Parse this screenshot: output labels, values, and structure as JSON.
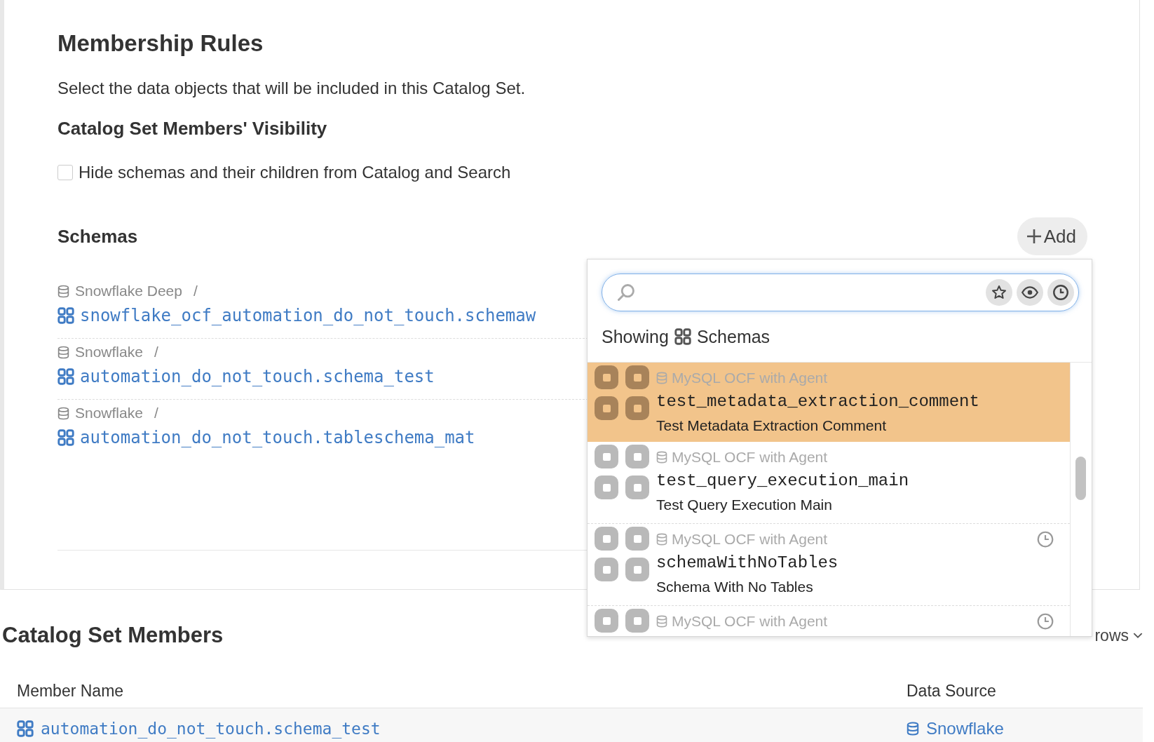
{
  "heading": "Membership Rules",
  "description": "Select the data objects that will be included in this Catalog Set.",
  "visibility": {
    "title": "Catalog Set Members' Visibility",
    "checkbox": {
      "label": "Hide schemas and their children from Catalog and Search",
      "checked": false
    }
  },
  "schemas": {
    "title": "Schemas",
    "add_label": "Add",
    "items": [
      {
        "source": "Snowflake Deep",
        "separator": "/",
        "name": "snowflake_ocf_automation_do_not_touch.schemaw"
      },
      {
        "source": "Snowflake",
        "separator": "/",
        "name": "automation_do_not_touch.schema_test"
      },
      {
        "source": "Snowflake",
        "separator": "/",
        "name": "automation_do_not_touch.tableschema_mat"
      }
    ]
  },
  "picker": {
    "showing_label": "Showing",
    "showing_type": "Schemas",
    "results": [
      {
        "source": "MySQL OCF with Agent",
        "name": "test_metadata_extraction_comment",
        "title": "Test Metadata Extraction Comment",
        "selected": true,
        "recent": false
      },
      {
        "source": "MySQL OCF with Agent",
        "name": "test_query_execution_main",
        "title": "Test Query Execution Main",
        "selected": false,
        "recent": false
      },
      {
        "source": "MySQL OCF with Agent",
        "name": "schemaWithNoTables",
        "title": "Schema With No Tables",
        "selected": false,
        "recent": true
      },
      {
        "source": "MySQL OCF with Agent",
        "selected": false,
        "recent": true
      }
    ]
  },
  "members": {
    "title": "Catalog Set Members",
    "page_size_label": "rows",
    "columns": [
      "Member Name",
      "Data Source"
    ],
    "rows": [
      {
        "name": "automation_do_not_touch.schema_test",
        "source": "Snowflake"
      }
    ]
  }
}
